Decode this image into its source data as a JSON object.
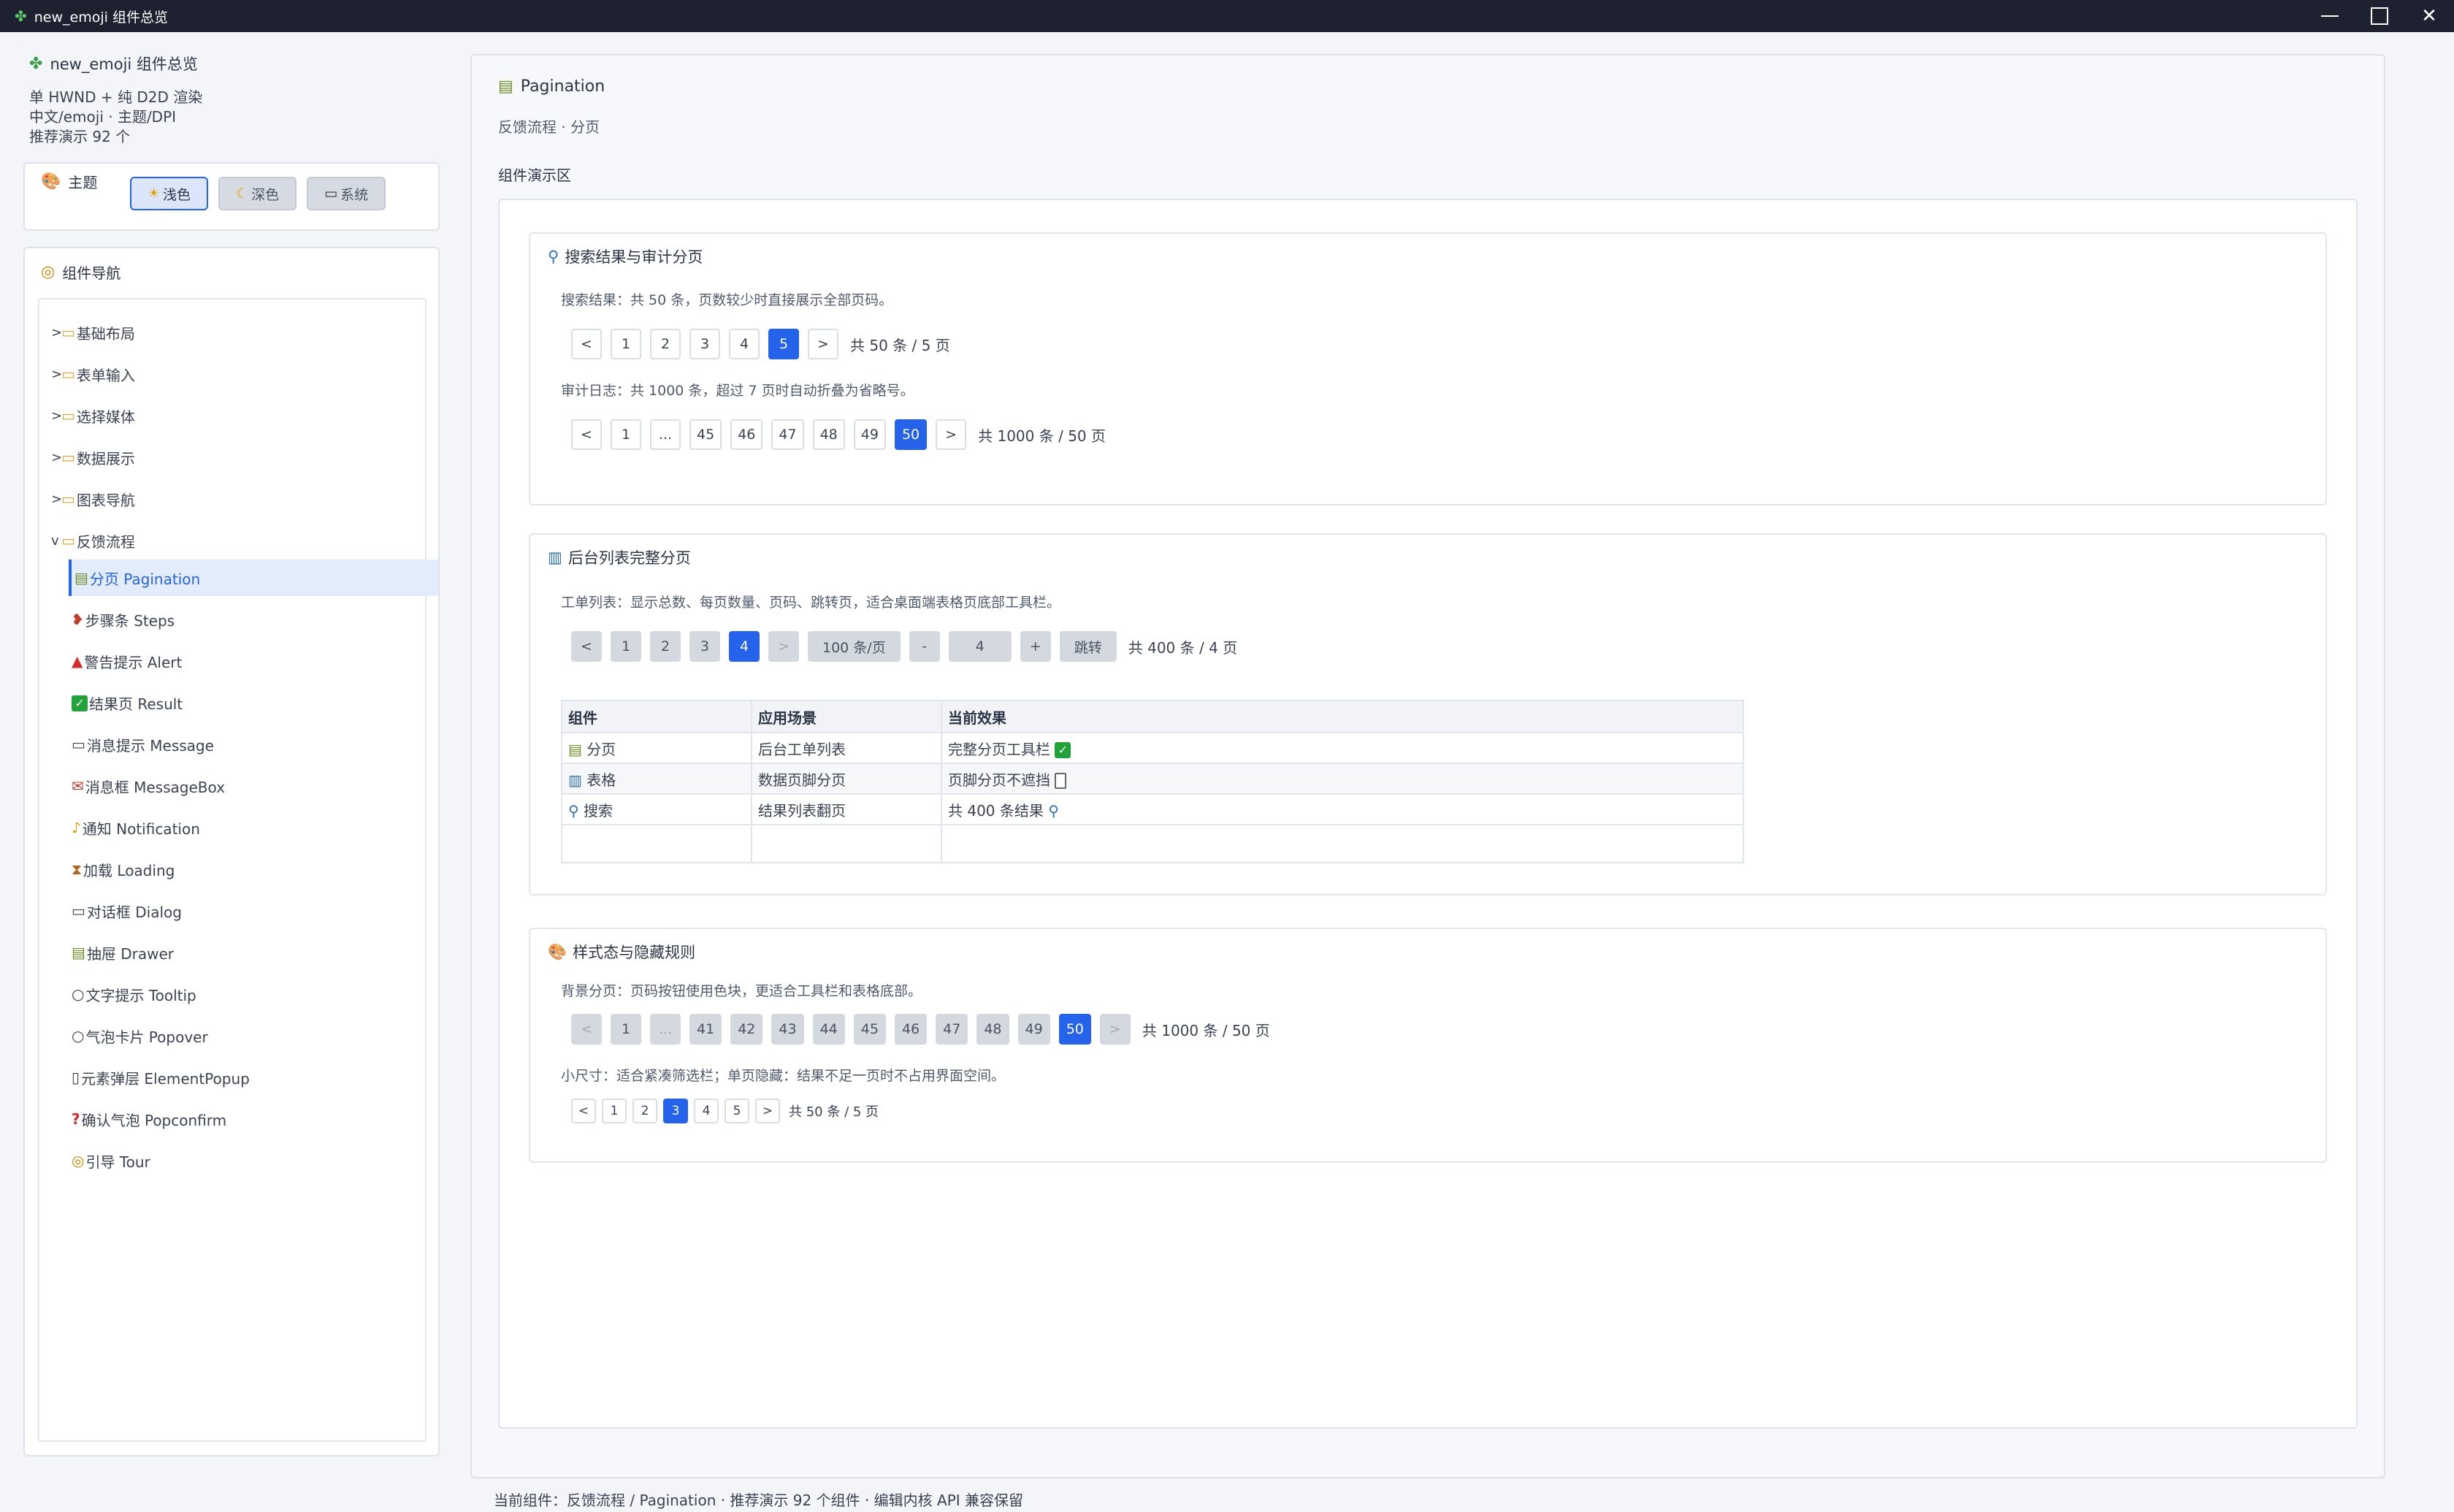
{
  "window": {
    "title": "new_emoji 组件总览"
  },
  "sidebar": {
    "app_name": "new_emoji 组件总览",
    "meta1": "单 HWND + 纯 D2D 渲染",
    "meta2": "中文/emoji · 主题/DPI",
    "meta3": "推荐演示 92 个",
    "theme_label": "主题",
    "theme_buttons": [
      {
        "label": "浅色",
        "icon": "sun-icon"
      },
      {
        "label": "深色",
        "icon": "moon-icon"
      },
      {
        "label": "系统",
        "icon": "laptop-icon"
      }
    ],
    "nav_label": "组件导航",
    "groups": [
      {
        "arrow": ">",
        "label": "基础布局"
      },
      {
        "arrow": ">",
        "label": "表单输入"
      },
      {
        "arrow": ">",
        "label": "选择媒体"
      },
      {
        "arrow": ">",
        "label": "数据展示"
      },
      {
        "arrow": ">",
        "label": "图表导航"
      },
      {
        "arrow": "v",
        "label": "反馈流程"
      }
    ],
    "children": [
      {
        "label": "分页 Pagination"
      },
      {
        "label": "步骤条 Steps"
      },
      {
        "label": "警告提示 Alert"
      },
      {
        "label": "结果页 Result"
      },
      {
        "label": "消息提示 Message"
      },
      {
        "label": "消息框 MessageBox"
      },
      {
        "label": "通知 Notification"
      },
      {
        "label": "加载 Loading"
      },
      {
        "label": "对话框 Dialog"
      },
      {
        "label": "抽屉 Drawer"
      },
      {
        "label": "文字提示 Tooltip"
      },
      {
        "label": "气泡卡片 Popover"
      },
      {
        "label": "元素弹层 ElementPopup"
      },
      {
        "label": "确认气泡 Popconfirm"
      },
      {
        "label": "引导 Tour"
      }
    ]
  },
  "main": {
    "title": "Pagination",
    "subtitle": "反馈流程 · 分页",
    "demo_label": "组件演示区",
    "card1": {
      "title": "搜索结果与审计分页",
      "desc1": "搜索结果：共 50 条，页数较少时直接展示全部页码。",
      "pager1": {
        "prev": "<",
        "pages": [
          "1",
          "2",
          "3",
          "4",
          "5"
        ],
        "next": ">",
        "total": "共 50 条 / 5 页"
      },
      "desc2": "审计日志：共 1000 条，超过 7 页时自动折叠为省略号。",
      "pager2": {
        "prev": "<",
        "pages": [
          "1",
          "...",
          "45",
          "46",
          "47",
          "48",
          "49",
          "50"
        ],
        "next": ">",
        "total": "共 1000 条 / 50 页"
      }
    },
    "card2": {
      "title": "后台列表完整分页",
      "desc": "工单列表：显示总数、每页数量、页码、跳转页，适合桌面端表格页底部工具栏。",
      "pager": {
        "prev": "<",
        "pages": [
          "1",
          "2",
          "3",
          "4"
        ],
        "next": ">",
        "size": "100 条/页",
        "minus": "-",
        "jump_value": "4",
        "plus": "+",
        "jump": "跳转",
        "total": "共 400 条 / 4 页"
      },
      "table": {
        "headers": [
          "组件",
          "应用场景",
          "当前效果"
        ],
        "rows": [
          {
            "c1": "分页",
            "c2": "后台工单列表",
            "c3": "完整分页工具栏"
          },
          {
            "c1": "表格",
            "c2": "数据页脚分页",
            "c3": "页脚分页不遮挡"
          },
          {
            "c1": "搜索",
            "c2": "结果列表翻页",
            "c3": "共 400 条结果"
          }
        ]
      }
    },
    "card3": {
      "title": "样式态与隐藏规则",
      "desc1": "背景分页：页码按钮使用色块，更适合工具栏和表格底部。",
      "pager1": {
        "prev": "<",
        "pages": [
          "1",
          "...",
          "41",
          "42",
          "43",
          "44",
          "45",
          "46",
          "47",
          "48",
          "49",
          "50"
        ],
        "next": ">",
        "total": "共 1000 条 / 50 页"
      },
      "desc2": "小尺寸：适合紧凑筛选栏；单页隐藏：结果不足一页时不占用界面空间。",
      "pager2": {
        "prev": "<",
        "pages": [
          "1",
          "2",
          "3",
          "4",
          "5"
        ],
        "next": ">",
        "total": "共 50 条 / 5 页"
      }
    }
  },
  "status": "当前组件：反馈流程 / Pagination · 推荐演示 92 个组件 · 编辑内核 API 兼容保留"
}
